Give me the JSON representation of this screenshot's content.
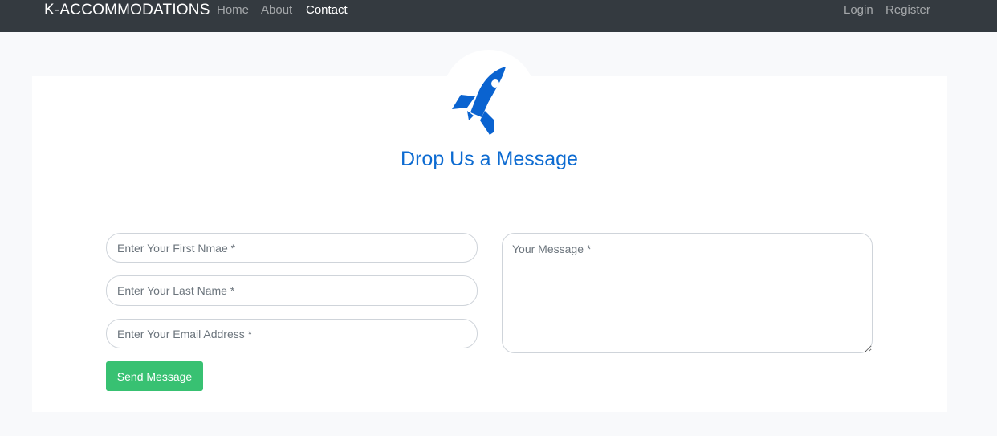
{
  "navbar": {
    "brand": "K-ACCOMMODATIONS",
    "links": [
      {
        "label": "Home",
        "active": false
      },
      {
        "label": "About",
        "active": false
      },
      {
        "label": "Contact",
        "active": true
      }
    ],
    "auth": {
      "login": "Login",
      "register": "Register"
    }
  },
  "form": {
    "icon": "rocket-icon",
    "title": "Drop Us a Message",
    "first_name": {
      "value": "",
      "placeholder": "Enter Your First Nmae *"
    },
    "last_name": {
      "value": "",
      "placeholder": "Enter Your Last Name *"
    },
    "email": {
      "value": "",
      "placeholder": "Enter Your Email Address *"
    },
    "message": {
      "value": "",
      "placeholder": "Your Message *"
    },
    "submit_label": "Send Message"
  },
  "colors": {
    "navbar_bg": "#343a40",
    "accent": "#0d6bd1",
    "button": "#38c172",
    "page_bg": "#f8f9fb"
  }
}
